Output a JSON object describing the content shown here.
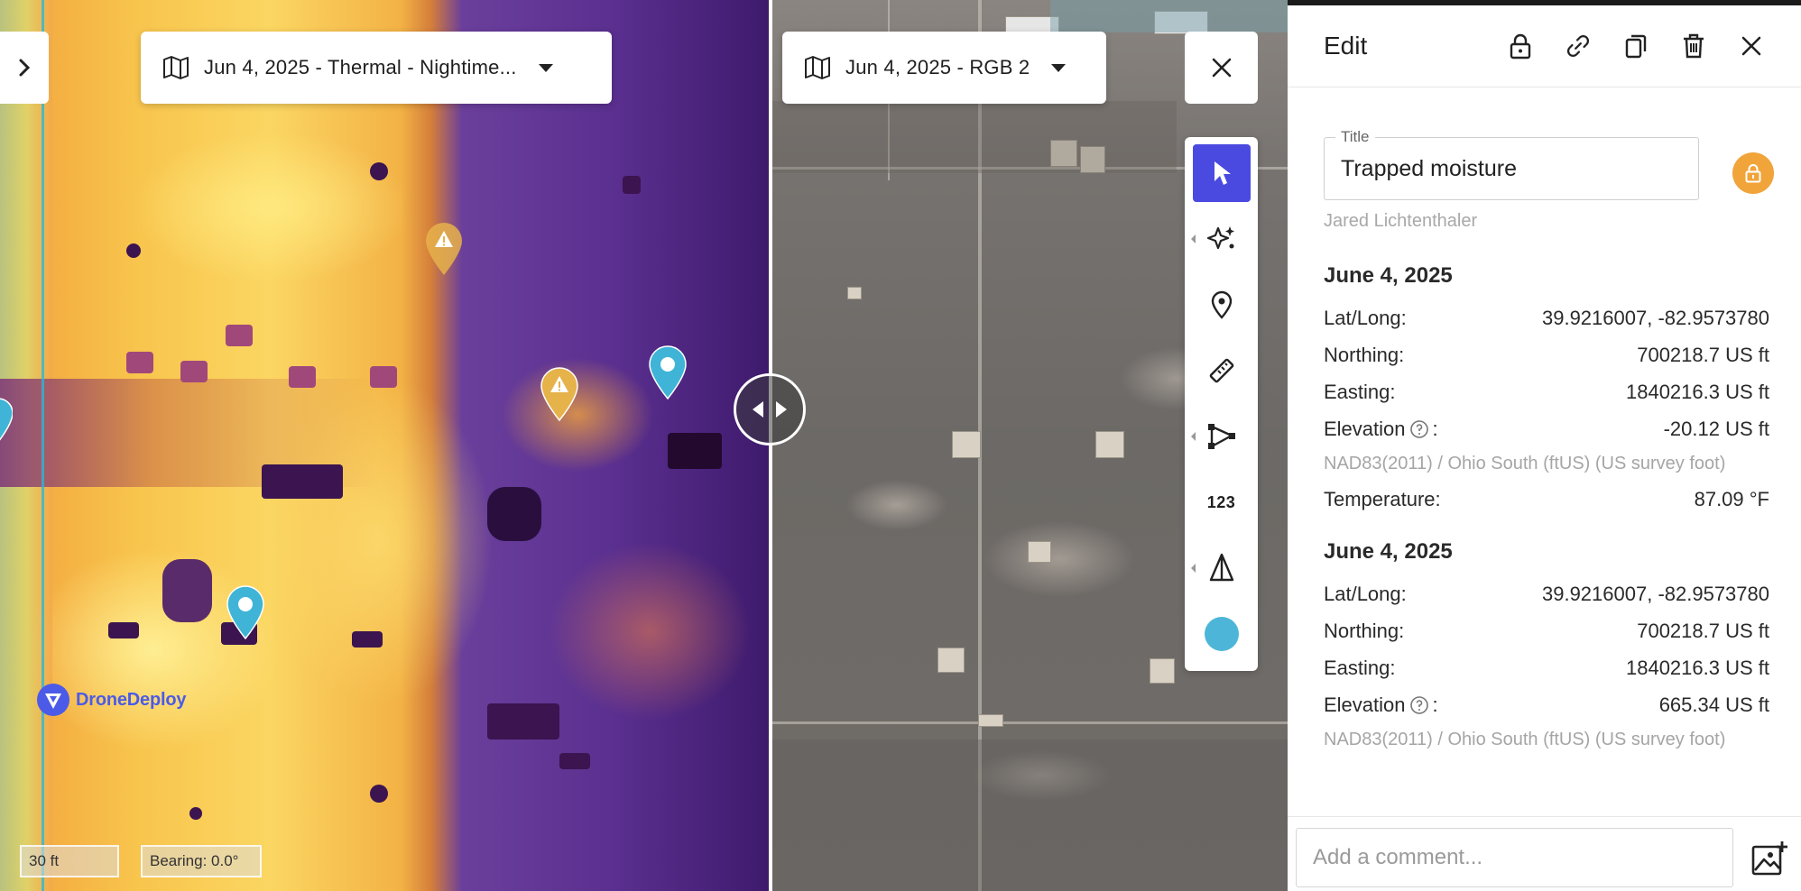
{
  "left_pane": {
    "layer_label": "Jun 4, 2025 - Thermal - Nightime...",
    "scale_label": "30 ft",
    "bearing_label": "Bearing: 0.0°",
    "logo_text": "DroneDeploy"
  },
  "right_pane": {
    "layer_label": "Jun 4, 2025 - RGB 2"
  },
  "toolbar": {
    "number_tool_label": "123",
    "active_color": "#4db6d8",
    "active_tool_color": "#4a4ae0"
  },
  "markers": {
    "warning_color": "#e6b24a",
    "pin_color": "#3fb4d6"
  },
  "panel": {
    "header_title": "Edit",
    "title_field_label": "Title",
    "title_value": "Trapped moisture",
    "author": "Jared Lichtenthaler",
    "lock_color": "#f0a43a",
    "sections": [
      {
        "date": "June 4, 2025",
        "latlong_label": "Lat/Long:",
        "latlong_value": "39.9216007, -82.9573780",
        "northing_label": "Northing:",
        "northing_value": "700218.7 US ft",
        "easting_label": "Easting:",
        "easting_value": "1840216.3 US ft",
        "elevation_label": "Elevation",
        "elevation_value": "-20.12 US ft",
        "projection": "NAD83(2011) / Ohio South (ftUS) (US survey foot)",
        "temperature_label": "Temperature:",
        "temperature_value": "87.09 °F"
      },
      {
        "date": "June 4, 2025",
        "latlong_label": "Lat/Long:",
        "latlong_value": "39.9216007, -82.9573780",
        "northing_label": "Northing:",
        "northing_value": "700218.7 US ft",
        "easting_label": "Easting:",
        "easting_value": "1840216.3 US ft",
        "elevation_label": "Elevation",
        "elevation_value": "665.34 US ft",
        "projection": "NAD83(2011) / Ohio South (ftUS) (US survey foot)"
      }
    ],
    "comment_placeholder": "Add a comment..."
  }
}
